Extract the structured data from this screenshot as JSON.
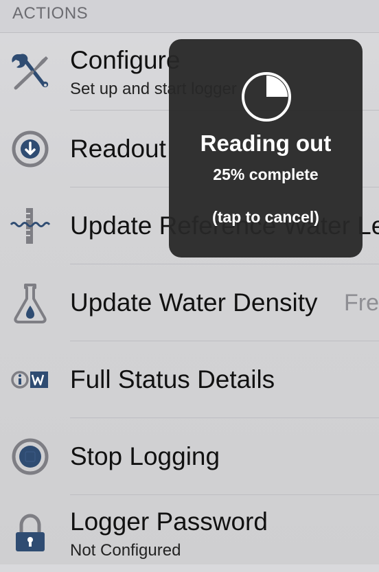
{
  "section_header": "ACTIONS",
  "colors": {
    "icon_blue": "#2f4c72",
    "icon_gray": "#7e7e84",
    "hud_background": "#282828"
  },
  "rows": [
    {
      "icon": "tools-icon",
      "title": "Configure",
      "subtitle": "Set up and start logger",
      "detail": ""
    },
    {
      "icon": "download-arrow-icon",
      "title": "Readout",
      "subtitle": "",
      "detail": ""
    },
    {
      "icon": "water-level-gauge-icon",
      "title": "Update Reference Water Le",
      "subtitle": "",
      "detail": ""
    },
    {
      "icon": "flask-icon",
      "title": "Update Water Density",
      "subtitle": "",
      "detail": "Fre"
    },
    {
      "icon": "info-logo-icon",
      "title": "Full Status Details",
      "subtitle": "",
      "detail": ""
    },
    {
      "icon": "stop-icon",
      "title": "Stop Logging",
      "subtitle": "",
      "detail": ""
    },
    {
      "icon": "padlock-icon",
      "title": "Logger Password",
      "subtitle": "Not Configured",
      "detail": ""
    }
  ],
  "hud": {
    "title": "Reading out",
    "status": "25% complete",
    "cancel_hint": "(tap to cancel)",
    "progress": 0.25
  }
}
